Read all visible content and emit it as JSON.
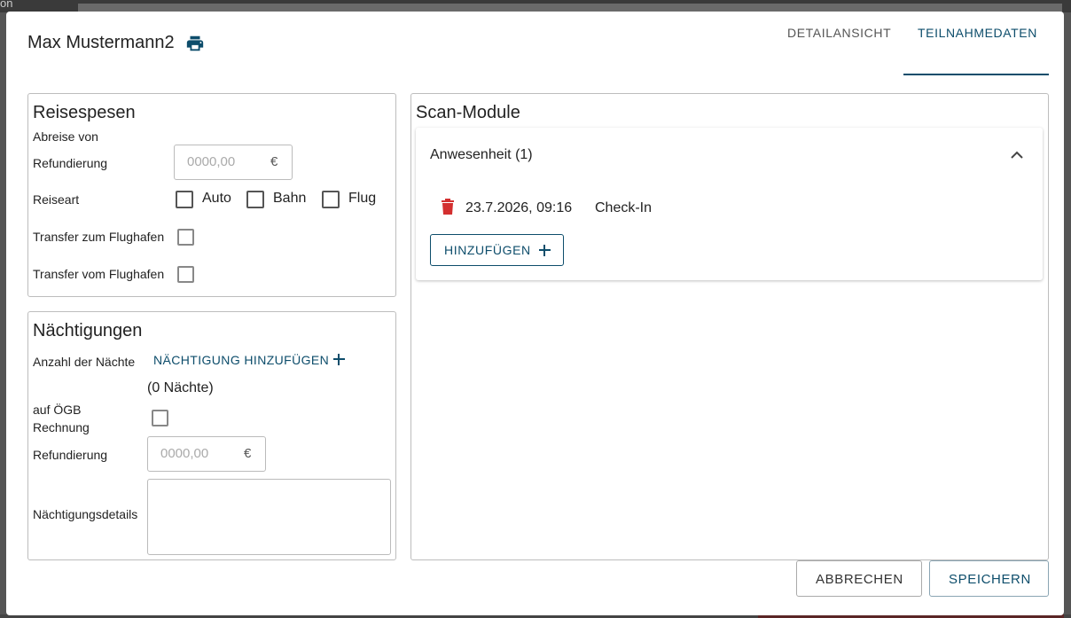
{
  "backdrop": {
    "fragment": "on"
  },
  "dialog": {
    "title": "Max Mustermann2",
    "tabs": [
      {
        "label": "DETAILANSICHT"
      },
      {
        "label": "TEILNAHMEDATEN"
      }
    ]
  },
  "reisespesen": {
    "title": "Reisespesen",
    "abreise_label": "Abreise von",
    "refund_label": "Refundierung",
    "refund_placeholder": "0000,00",
    "currency": "€",
    "reiseart_label": "Reiseart",
    "options": [
      {
        "label": "Auto"
      },
      {
        "label": "Bahn"
      },
      {
        "label": "Flug"
      }
    ],
    "transfer_to_label": "Transfer zum Flughafen",
    "transfer_from_label": "Transfer vom Flughafen"
  },
  "naechtigungen": {
    "title": "Nächtigungen",
    "count_label": "Anzahl der Nächte",
    "add_label": "NÄCHTIGUNG HINZUFÜGEN",
    "nights_text": "(0 Nächte)",
    "oegb_line1": "auf ÖGB",
    "oegb_line2": "Rechnung",
    "refund_label": "Refundierung",
    "refund_placeholder": "0000,00",
    "currency": "€",
    "details_label": "Nächtigungsdetails"
  },
  "scan": {
    "title": "Scan-Module",
    "card_title": "Anwesenheit (1)",
    "entries": [
      {
        "date": "23.7.2026, 09:16",
        "type": "Check-In"
      }
    ],
    "add_label": "HINZUFÜGEN"
  },
  "footer": {
    "cancel_label": "ABBRECHEN",
    "save_label": "SPEICHERN"
  },
  "colors": {
    "accent": "#0d4d6b",
    "delete": "#d32f2f"
  }
}
